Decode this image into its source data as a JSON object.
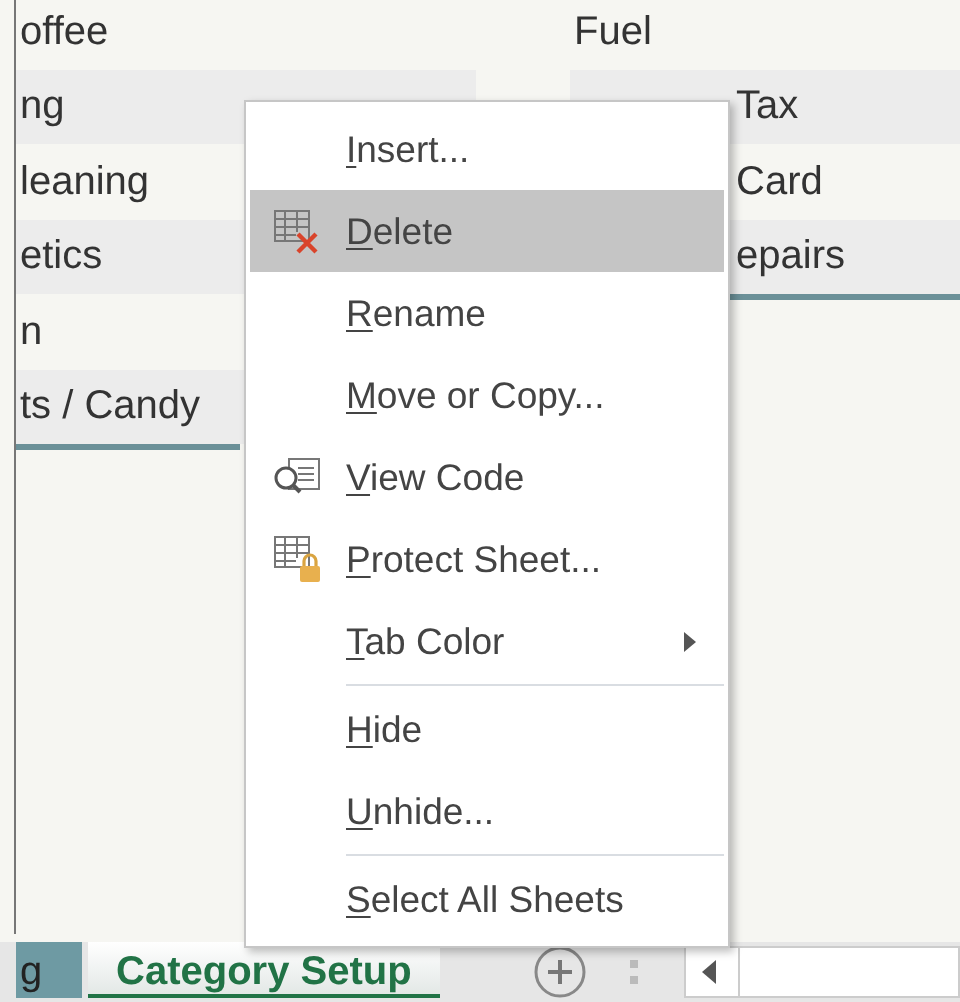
{
  "sheet": {
    "column_1": [
      "offee",
      "ng",
      "leaning",
      "etics",
      "n",
      "ts / Candy"
    ],
    "column_2": [
      "Fuel",
      "Tax",
      "Card",
      "epairs"
    ]
  },
  "context_menu": {
    "items": [
      {
        "kind": "plain",
        "label": "Insert...",
        "selected": false,
        "submenu": false
      },
      {
        "kind": "delete",
        "label": "Delete",
        "selected": true,
        "submenu": false
      },
      {
        "kind": "plain",
        "label": "Rename",
        "selected": false,
        "submenu": false
      },
      {
        "kind": "plain",
        "label": "Move or Copy...",
        "selected": false,
        "submenu": false
      },
      {
        "kind": "view-code",
        "label": "View Code",
        "selected": false,
        "submenu": false
      },
      {
        "kind": "protect",
        "label": "Protect Sheet...",
        "selected": false,
        "submenu": false
      },
      {
        "kind": "plain",
        "label": "Tab Color",
        "selected": false,
        "submenu": true
      },
      {
        "kind": "separator"
      },
      {
        "kind": "plain",
        "label": "Hide",
        "selected": false,
        "submenu": false
      },
      {
        "kind": "plain",
        "label": "Unhide...",
        "selected": false,
        "submenu": false
      },
      {
        "kind": "separator"
      },
      {
        "kind": "plain",
        "label": "Select All Sheets",
        "selected": false,
        "submenu": false
      }
    ]
  },
  "sheet_tabs": [
    {
      "label": "g",
      "selected": false
    },
    {
      "label": "Category Setup",
      "selected": true
    }
  ]
}
